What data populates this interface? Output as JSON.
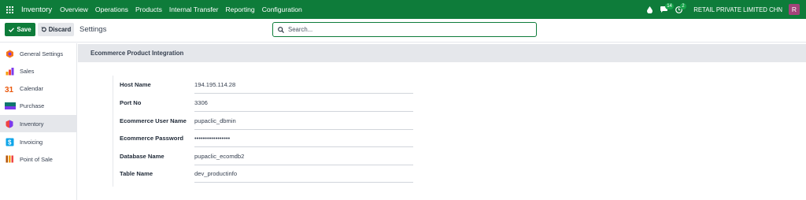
{
  "navbar": {
    "app_name": "Inventory",
    "menu": [
      "Overview",
      "Operations",
      "Products",
      "Internal Transfer",
      "Reporting",
      "Configuration"
    ],
    "messages_count": "14",
    "activities_count": "2",
    "company": "RETAIL PRIVATE LIMITED CHN",
    "avatar_letter": "R",
    "icons": [
      "apps-grid-icon",
      "droplet-icon",
      "chat-icon",
      "clock-icon"
    ]
  },
  "control_panel": {
    "save_label": "Save",
    "discard_label": "Discard",
    "title": "Settings",
    "search_placeholder": "Search..."
  },
  "sidebar": {
    "items": [
      {
        "label": "General Settings",
        "icon": "general-settings-icon",
        "color": "#f97316"
      },
      {
        "label": "Sales",
        "icon": "sales-icon",
        "color": "#f59e0b"
      },
      {
        "label": "Calendar",
        "icon": "calendar-icon",
        "color": "#ea580c"
      },
      {
        "label": "Purchase",
        "icon": "purchase-icon",
        "color": "#0f766e"
      },
      {
        "label": "Inventory",
        "icon": "inventory-icon",
        "color": "#ef4444",
        "active": true
      },
      {
        "label": "Invoicing",
        "icon": "invoicing-icon",
        "color": "#0ea5e9"
      },
      {
        "label": "Point of Sale",
        "icon": "point-of-sale-icon",
        "color": "#b45309"
      }
    ]
  },
  "section": {
    "title": "Ecommerce Product Integration",
    "fields": [
      {
        "label": "Host Name",
        "value": "194.195.114.28"
      },
      {
        "label": "Port No",
        "value": "3306"
      },
      {
        "label": "Ecommerce User Name",
        "value": "pupaclic_dbmin"
      },
      {
        "label": "Ecommerce Password",
        "value": "•••••••••••••••••"
      },
      {
        "label": "Database Name",
        "value": "pupaclic_ecomdb2"
      },
      {
        "label": "Table Name",
        "value": "dev_productinfo"
      }
    ]
  },
  "colors": {
    "brand_green": "#0e7c3a",
    "avatar": "#a3437a",
    "section_bg": "#e5e7eb"
  }
}
